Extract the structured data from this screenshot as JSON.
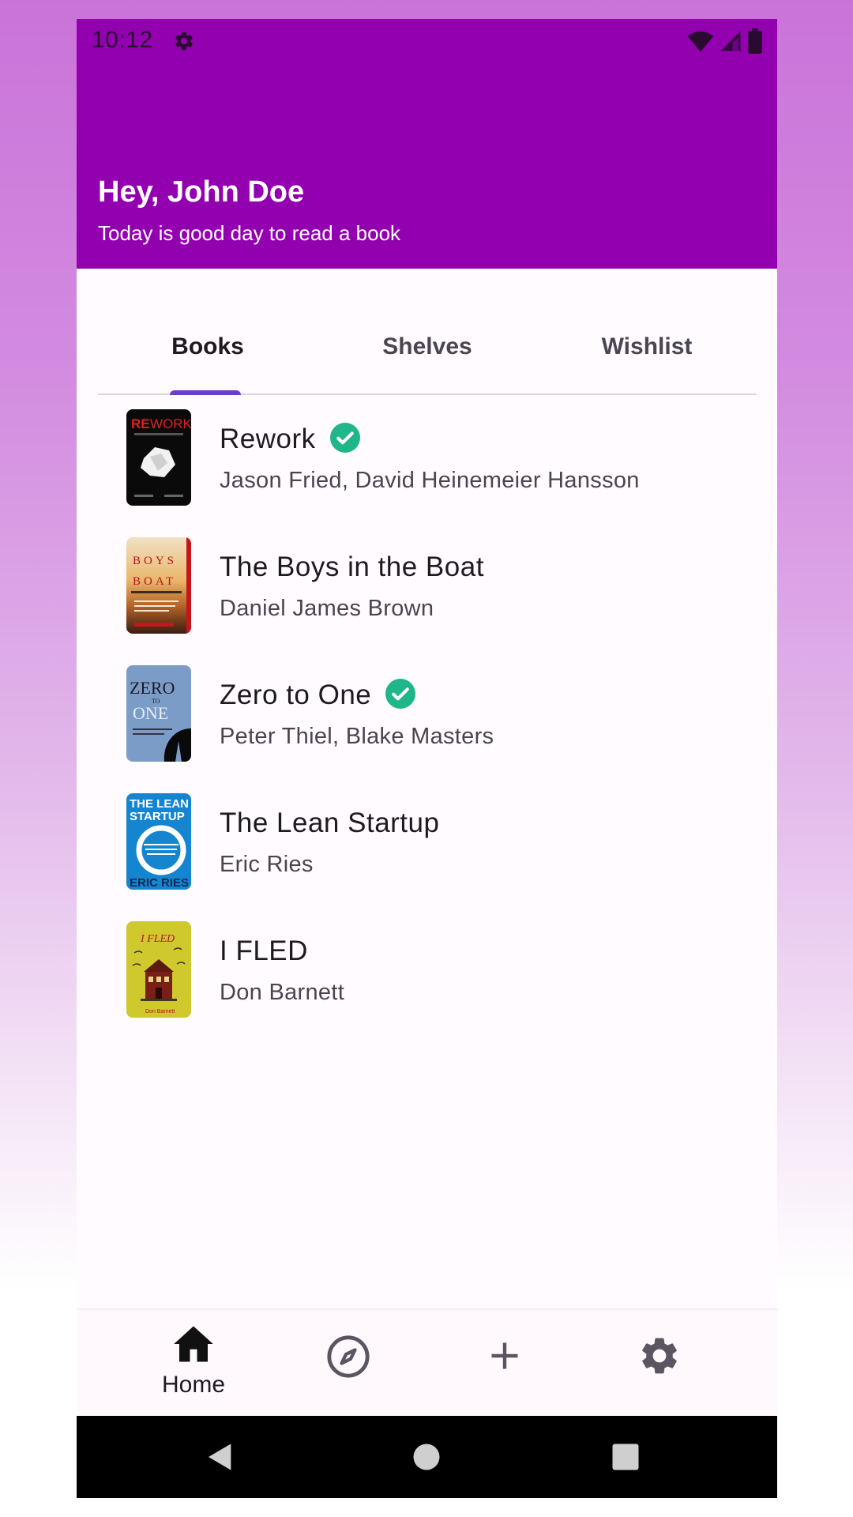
{
  "status_bar": {
    "time": "10:12"
  },
  "header": {
    "greeting": "Hey, John Doe",
    "subtitle": "Today is good day to read a book",
    "background": "#9300b0"
  },
  "tabs": [
    {
      "label": "Books",
      "active": true
    },
    {
      "label": "Shelves",
      "active": false
    },
    {
      "label": "Wishlist",
      "active": false
    }
  ],
  "books": [
    {
      "title": "Rework",
      "author": "Jason Fried, David Heinemeier Hansson",
      "finished": true
    },
    {
      "title": "The Boys in the Boat",
      "author": "Daniel James Brown",
      "finished": false
    },
    {
      "title": "Zero to One",
      "author": "Peter Thiel, Blake Masters",
      "finished": true
    },
    {
      "title": "The Lean Startup",
      "author": "Eric Ries",
      "finished": false
    },
    {
      "title": "I FLED",
      "author": "Don Barnett",
      "finished": false
    }
  ],
  "bottom_nav": {
    "home_label": "Home",
    "items": [
      "home-icon",
      "explore-icon",
      "add-icon",
      "settings-icon"
    ]
  },
  "colors": {
    "accent": "#6a3fc8",
    "check": "#1fb68a"
  }
}
